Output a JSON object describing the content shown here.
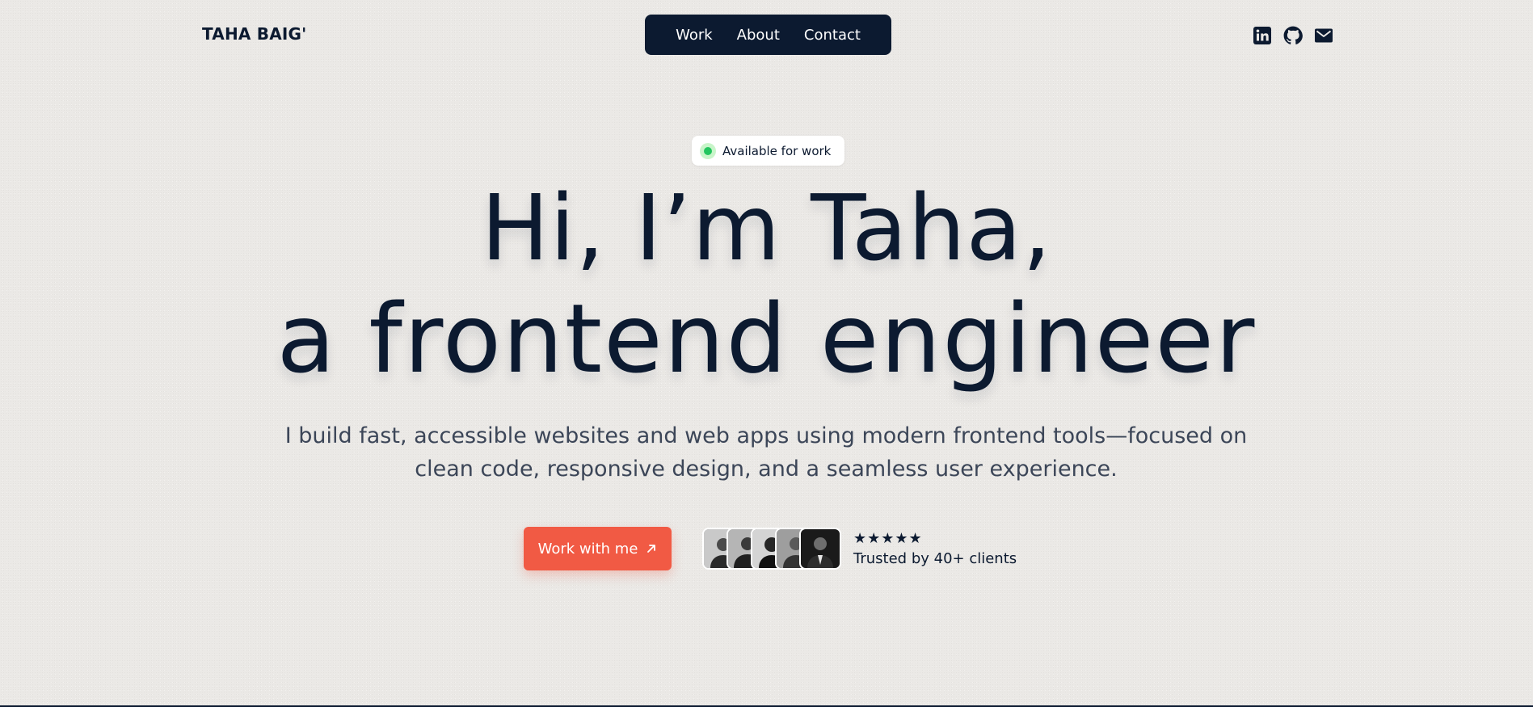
{
  "header": {
    "logo": "TAHA BAIG'",
    "nav": [
      {
        "label": "Work"
      },
      {
        "label": "About"
      },
      {
        "label": "Contact"
      }
    ],
    "socials": [
      "linkedin-icon",
      "github-icon",
      "mail-icon"
    ]
  },
  "hero": {
    "badge": "Available for work",
    "headline_line1": "Hi, I’m Taha,",
    "headline_line2": "a frontend engineer",
    "subtitle_line1": "I build fast, accessible websites and web apps using modern frontend tools—focused on",
    "subtitle_line2": "clean code, responsive design, and a seamless user experience.",
    "cta_label": "Work with me",
    "stars": "★★★★★",
    "trusted_text": "Trusted by 40+ clients",
    "avatar_count": 5
  },
  "colors": {
    "background": "#ebe9e6",
    "navy": "#0c1a30",
    "accent": "#f15a44",
    "status_green": "#22c55e"
  }
}
